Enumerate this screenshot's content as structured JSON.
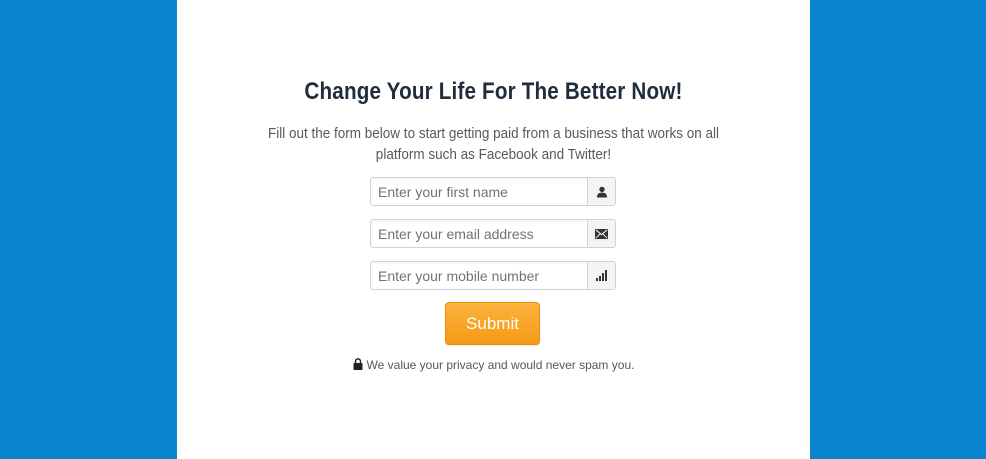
{
  "colors": {
    "page_background": "#0a84cf",
    "panel": "#ffffff",
    "accent_button": "#f7a21e"
  },
  "header": {
    "title": "Change Your Life For The Better Now!",
    "subtitle": "Fill out the form below to start getting paid from a business that works on all platform such as Facebook and Twitter!"
  },
  "form": {
    "first_name": {
      "placeholder": "Enter your first name",
      "value": "",
      "icon": "user-icon"
    },
    "email": {
      "placeholder": "Enter your email address",
      "value": "",
      "icon": "envelope-icon"
    },
    "mobile": {
      "placeholder": "Enter your mobile number",
      "value": "",
      "icon": "signal-icon"
    },
    "submit_label": "Submit"
  },
  "privacy": {
    "icon": "lock-icon",
    "text": "We value your privacy and would never spam you."
  }
}
